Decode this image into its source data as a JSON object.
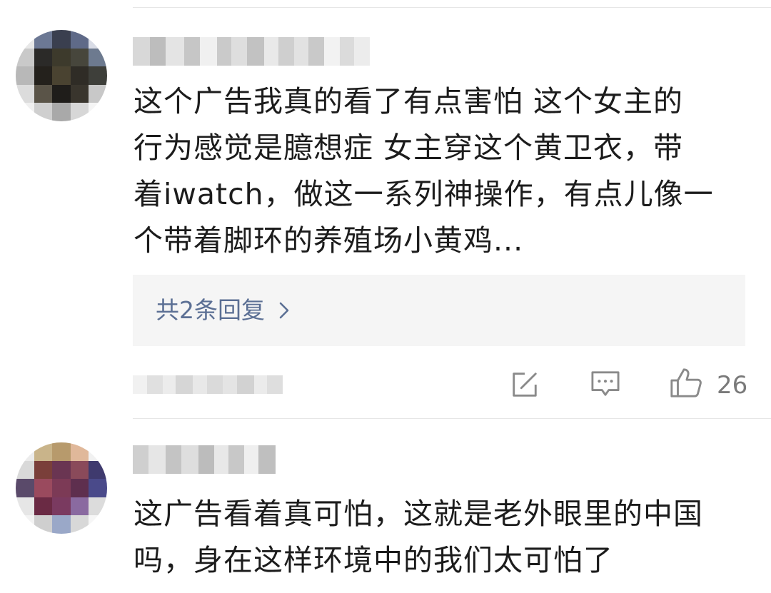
{
  "comments": [
    {
      "text_lines": [
        "这个广告我真的看了有点害怕 这个女主的",
        "行为感觉是臆想症 女主穿这个黄卫衣，带",
        "着iwatch，做这一系列神操作，有点儿像一",
        "个带着脚环的养殖场小黄鸡..."
      ],
      "reply_label": "共2条回复",
      "likes": "26",
      "icons": [
        "share-icon",
        "comment-icon",
        "like-icon",
        "chevron-right-icon"
      ]
    },
    {
      "text_lines": [
        "这广告看着真可怕，这就是老外眼里的中国",
        "吗，身在这样环境中的我们太可怕了"
      ]
    }
  ],
  "colors": {
    "reply_link": "#5b6f94",
    "reply_box_bg": "#f5f5f5",
    "icon_gray": "#8a8a8a",
    "divider": "#e6e6e6"
  }
}
